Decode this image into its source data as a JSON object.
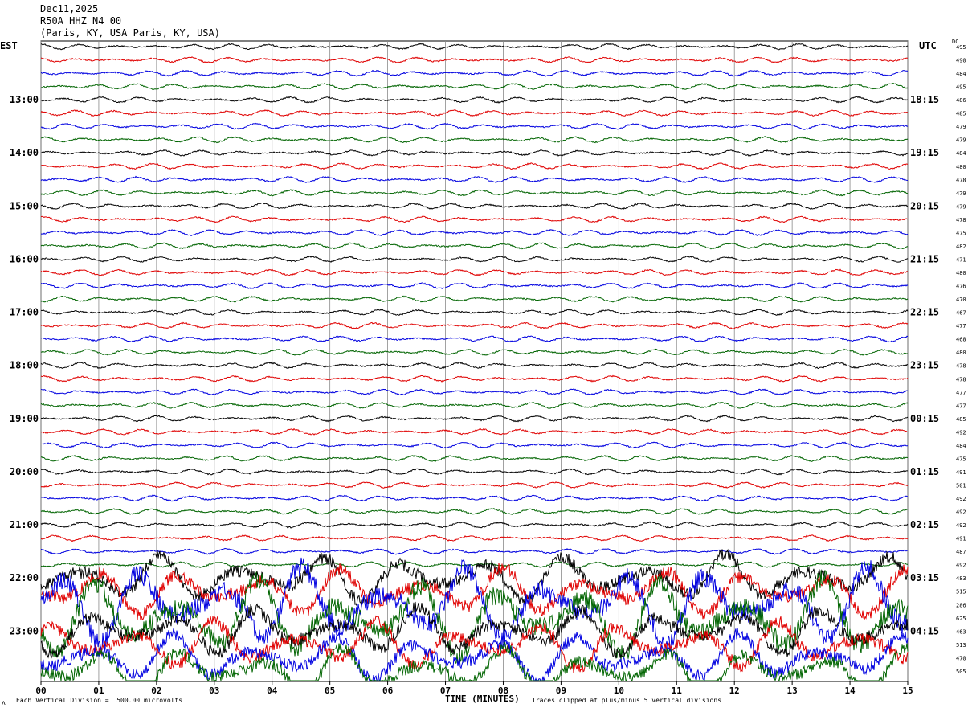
{
  "header": {
    "date": "Dec11,2025",
    "station": "R50A HHZ N4 00",
    "location": "(Paris, KY, USA Paris, KY, USA)"
  },
  "left_axis_label": "EST",
  "right_axis_label": "UTC",
  "dc_label": "DC",
  "footer": {
    "scale_note": "Each Vertical Division =  500.00 microvolts",
    "xlabel": "TIME (MINUTES)",
    "clip_note": "Traces clipped at plus/minus 5 vertical divisions",
    "corner_mark": "ʌ"
  },
  "colors": {
    "trace_cycle": [
      "#000000",
      "#e00000",
      "#0000e0",
      "#006400"
    ],
    "grid": "#8a8a8a",
    "frame": "#000000"
  },
  "chart_data": {
    "type": "line",
    "description_free": true,
    "x_ticks": [
      "00",
      "01",
      "02",
      "03",
      "04",
      "05",
      "06",
      "07",
      "08",
      "09",
      "10",
      "11",
      "12",
      "13",
      "14",
      "15"
    ],
    "xlim": [
      0,
      15
    ],
    "rows": 48,
    "est_labels": [
      {
        "row": 4,
        "text": "13:00"
      },
      {
        "row": 8,
        "text": "14:00"
      },
      {
        "row": 12,
        "text": "15:00"
      },
      {
        "row": 16,
        "text": "16:00"
      },
      {
        "row": 20,
        "text": "17:00"
      },
      {
        "row": 24,
        "text": "18:00"
      },
      {
        "row": 28,
        "text": "19:00"
      },
      {
        "row": 32,
        "text": "20:00"
      },
      {
        "row": 36,
        "text": "21:00"
      },
      {
        "row": 40,
        "text": "22:00"
      },
      {
        "row": 44,
        "text": "23:00"
      }
    ],
    "utc_labels": [
      {
        "row": 4,
        "text": "18:15"
      },
      {
        "row": 8,
        "text": "19:15"
      },
      {
        "row": 12,
        "text": "20:15"
      },
      {
        "row": 16,
        "text": "21:15"
      },
      {
        "row": 20,
        "text": "22:15"
      },
      {
        "row": 24,
        "text": "23:15"
      },
      {
        "row": 28,
        "text": "00:15"
      },
      {
        "row": 32,
        "text": "01:15"
      },
      {
        "row": 36,
        "text": "02:15"
      },
      {
        "row": 40,
        "text": "03:15"
      },
      {
        "row": 44,
        "text": "04:15"
      }
    ],
    "dc_values": [
      "495",
      "490",
      "484",
      "495",
      "486",
      "485",
      "479",
      "479",
      "484",
      "480",
      "478",
      "479",
      "479",
      "478",
      "475",
      "482",
      "471",
      "480",
      "476",
      "470",
      "467",
      "477",
      "468",
      "480",
      "478",
      "478",
      "477",
      "477",
      "485",
      "492",
      "484",
      "475",
      "491",
      "501",
      "492",
      "492",
      "492",
      "491",
      "487",
      "492",
      "483",
      "515",
      "286",
      "625",
      "463",
      "513",
      "470",
      "505"
    ]
  }
}
